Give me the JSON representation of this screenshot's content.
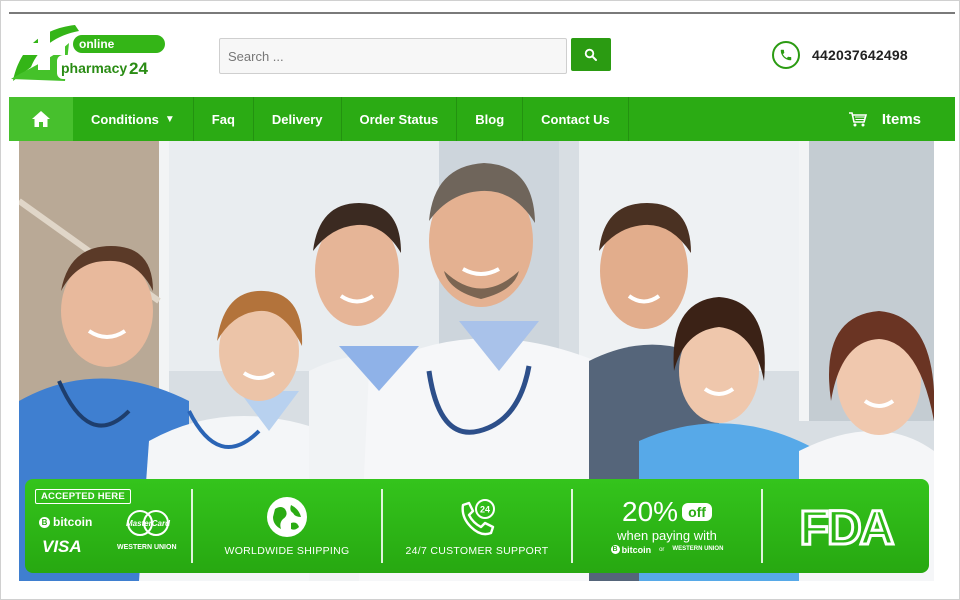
{
  "header": {
    "logo": {
      "top_word": "online",
      "bottom_word": "pharmacy",
      "number": "24"
    },
    "search": {
      "placeholder": "Search ...",
      "value": ""
    },
    "phone": "442037642498"
  },
  "nav": {
    "items": [
      {
        "label": "Conditions",
        "has_dropdown": true
      },
      {
        "label": "Faq"
      },
      {
        "label": "Delivery"
      },
      {
        "label": "Order Status"
      },
      {
        "label": "Blog"
      },
      {
        "label": "Contact Us"
      }
    ],
    "cart_label": "Items"
  },
  "banner": {
    "accepted_here": "ACCEPTED HERE",
    "bitcoin": "bitcoin",
    "visa": "VISA",
    "mastercard": "MasterCard",
    "western_union": "WESTERN UNION",
    "shipping": "WORLDWIDE SHIPPING",
    "support": "24/7 CUSTOMER SUPPORT",
    "support_badge": "24",
    "discount_pct": "20%",
    "discount_off": "off",
    "discount_when": "when paying with",
    "discount_or": "or",
    "fda": "FDA"
  },
  "colors": {
    "brand_green": "#2bab14",
    "home_green": "#47c02d",
    "banner_green": "#2fb817"
  },
  "icons": [
    "home-icon",
    "search-icon",
    "phone-icon",
    "caret-down-icon",
    "cart-icon",
    "globe-icon",
    "support-phone-icon"
  ]
}
